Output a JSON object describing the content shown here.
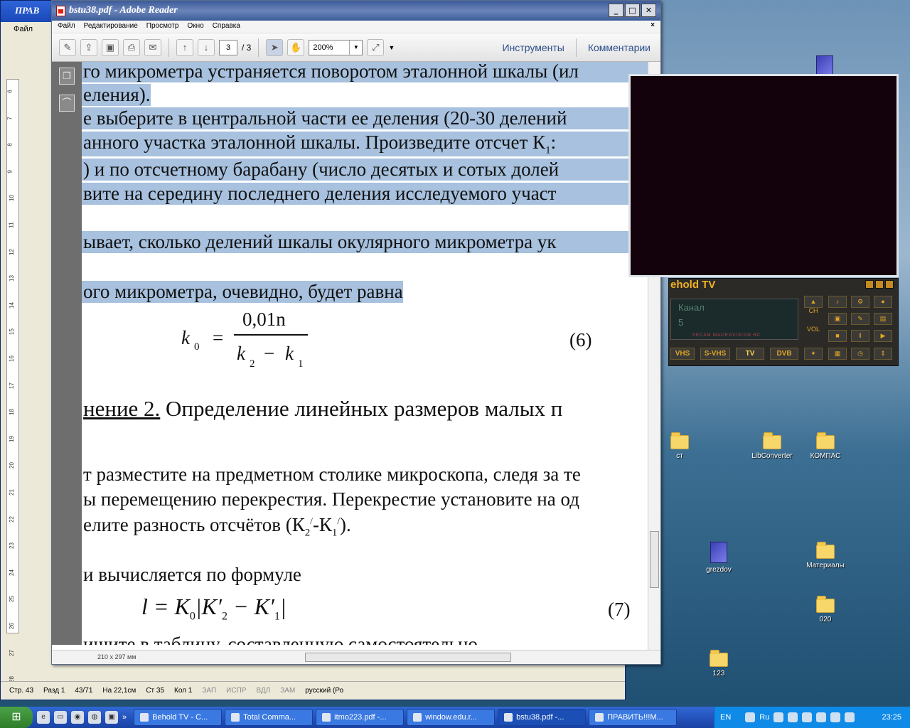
{
  "desktop": {
    "icons": [
      {
        "label": "ст",
        "type": "folder"
      },
      {
        "label": "LibConverter",
        "type": "folder"
      },
      {
        "label": "КОМПАС",
        "type": "folder"
      },
      {
        "label": "grezdov",
        "type": "doc"
      },
      {
        "label": "Материалы",
        "type": "folder"
      },
      {
        "label": "020",
        "type": "folder"
      },
      {
        "label": "123",
        "type": "folder"
      }
    ]
  },
  "word": {
    "title": "ПРАВ",
    "menu_file": "Файл",
    "status": {
      "page": "Стр. 43",
      "section": "Разд 1",
      "pages": "43/71",
      "at": "На 22,1см",
      "line": "Ст 35",
      "col": "Кол 1",
      "rec": "ЗАП",
      "trk": "ИСПР",
      "ext": "ВДЛ",
      "ovr": "ЗАМ",
      "lang": "русский (Ро"
    },
    "ruler_numbers": [
      "6",
      "7",
      "8",
      "9",
      "10",
      "11",
      "12",
      "13",
      "14",
      "15",
      "16",
      "17",
      "18",
      "19",
      "20",
      "21",
      "22",
      "23",
      "24",
      "25",
      "26",
      "27",
      "28"
    ]
  },
  "reader": {
    "title": "bstu38.pdf - Adobe Reader",
    "menu": [
      "Файл",
      "Редактирование",
      "Просмотр",
      "Окно",
      "Справка"
    ],
    "close_doc": "×",
    "page_current": "3",
    "page_total": "/ 3",
    "zoom": "200%",
    "tools_link": "Инструменты",
    "comments_link": "Комментарии",
    "page_size": "210 x 297 мм",
    "content": {
      "l1": "го микрометра устраняется поворотом эталонной шкалы (ил",
      "l2": "еления).",
      "l3": "е выберите в центральной части ее деления (20-30 делений",
      "l4a": "анного участка эталонной шкалы. Произведите отсчет К",
      "l4sub": "1",
      "l4b": ":",
      "l5": ") и по отсчетному барабану (число десятых и сотых долей",
      "l6": "вите на середину последнего деления исследуемого участ",
      "l7": "ывает, сколько делений шкалы окулярного микрометра ук",
      "l8": "ого микрометра, очевидно, будет равна",
      "f6_num": "0,01n",
      "f6_lhs": "k",
      "f6_lhs_sub": "0",
      "f6_den_a": "k",
      "f6_den_a_sub": "2",
      "f6_minus": "−",
      "f6_den_b": "k",
      "f6_den_b_sub": "1",
      "f6_eq": "=",
      "f6_no": "(6)",
      "heading_u": "нение 2.",
      "heading_rest": " Определение линейных размеров малых п",
      "l9": "т разместите на предметном столике микроскопа, следя за те",
      "l10": "ы перемещению перекрестия. Перекрестие установите на од",
      "l11a": "елите разность отсчётов (К",
      "l11b": "2",
      "l11c": "/",
      "l11d": "-К",
      "l11e": "1",
      "l11f": "/",
      "l11g": ").",
      "l12": "и вычисляется по формуле",
      "f7": "l = K",
      "f7_sub": "0",
      "f7_abs": "|K′",
      "f7_abs_sub2": "2",
      "f7_minus": " − K′",
      "f7_abs_sub1": "1",
      "f7_close": "|",
      "f7_no": "(7)",
      "l13": "ишите в таблицу, составленную самостоятельно."
    }
  },
  "tv": {
    "title": "ehold TV",
    "lcd_text": "Канал",
    "lcd_num": "5",
    "lcd_tags": "SECAM   MACROVISION   RC",
    "ch_label": "CH",
    "vol_label": "VOL",
    "buttons": [
      "VHS",
      "S-VHS",
      "TV",
      "DVB"
    ]
  },
  "taskbar": {
    "tasks": [
      "Behold TV - C...",
      "Total Comma...",
      "itmo223.pdf -...",
      "window.edu.r...",
      "bstu38.pdf -...",
      "ПРАВИТЬ!!!М..."
    ],
    "lang": "EN",
    "lang2": "Ru",
    "clock": "23:25",
    "chevron": "»"
  },
  "colors": {
    "highlight": "#a7c1de",
    "reader_title": "#3b5b99",
    "tv_accent": "#f2b020",
    "taskbar": "#3168d5"
  }
}
